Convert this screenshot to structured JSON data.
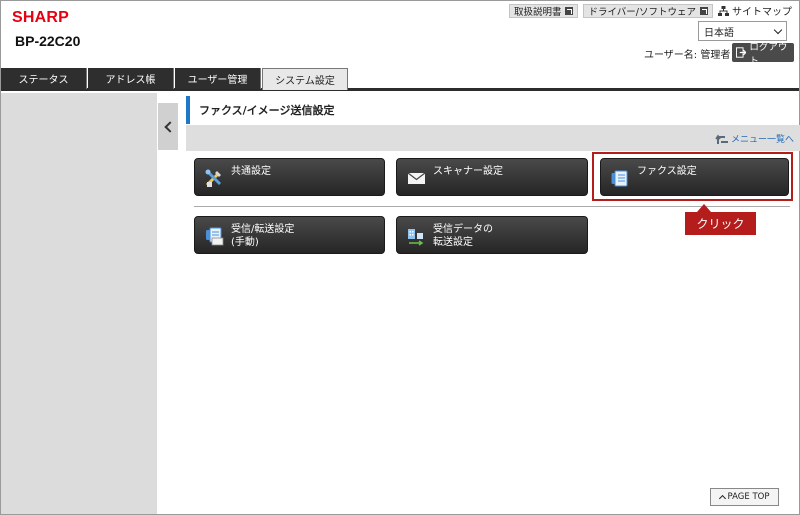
{
  "header": {
    "brand": "SHARP",
    "model": "BP-22C20",
    "links": {
      "manual": "取扱説明書",
      "driver": "ドライバー/ソフトウェア",
      "sitemap": "サイトマップ"
    },
    "language": "日本語",
    "user_label": "ユーザー名: 管理者",
    "logout_label": "ログアウト"
  },
  "tabs": [
    {
      "label": "ステータス",
      "active": false
    },
    {
      "label": "アドレス帳",
      "active": false
    },
    {
      "label": "ユーザー管理",
      "active": false
    },
    {
      "label": "システム設定",
      "active": true
    }
  ],
  "page": {
    "title": "ファクス/イメージ送信設定",
    "menu_link": "メニュー一覧へ"
  },
  "buttons": {
    "common": "共通設定",
    "scanner": "スキャナー設定",
    "fax": "ファクス設定",
    "receive_forward": "受信/転送設定\n(手動)",
    "receive_data": "受信データの\n転送設定"
  },
  "annotation": {
    "callout": "クリック",
    "color": "#b51c1c"
  },
  "footer": {
    "page_top": "PAGE TOP"
  },
  "colors": {
    "brand": "#e60012",
    "accent": "#1e78c8",
    "tab_dark": "#2e2e2e"
  }
}
